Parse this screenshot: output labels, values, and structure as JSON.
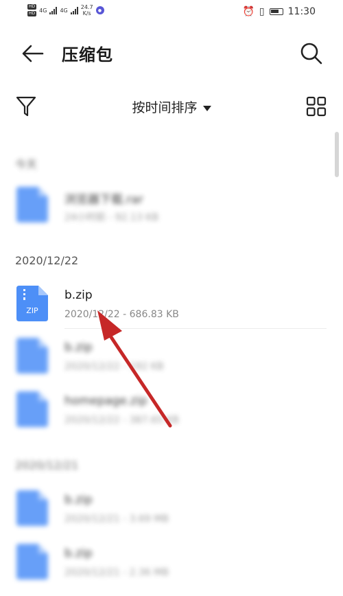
{
  "status_bar": {
    "hd1": "HD",
    "hd2": "HD",
    "net1": "4G",
    "net2": "4G",
    "speed_value": "24.7",
    "speed_unit": "K/s",
    "time": "11:30"
  },
  "header": {
    "title": "压缩包"
  },
  "toolbar": {
    "sort_label": "按时间排序"
  },
  "sections": [
    {
      "date": "今天"
    },
    {
      "date": "2020/12/22"
    },
    {
      "date": "2020/12/21"
    }
  ],
  "files": [
    {
      "name": "浏览器下载.rar",
      "meta": "24小时前 - 92.13 KB"
    },
    {
      "name": "b.zip",
      "meta": "2020/12/22 - 686.83 KB"
    },
    {
      "name": "b.zip",
      "meta": "2020/12/22 - 192 KB"
    },
    {
      "name": "homepage.zip",
      "meta": "2020/12/22 - 387.65 KB"
    },
    {
      "name": "b.zip",
      "meta": "2020/12/21 - 3.69 MB"
    },
    {
      "name": "b.zip",
      "meta": "2020/12/21 - 2.36 MB"
    }
  ],
  "icons": {
    "zip_label": "ZIP"
  },
  "colors": {
    "file_icon": "#4d8ff7",
    "file_icon_fold": "#a6c7fb",
    "arrow": "#c62828"
  }
}
